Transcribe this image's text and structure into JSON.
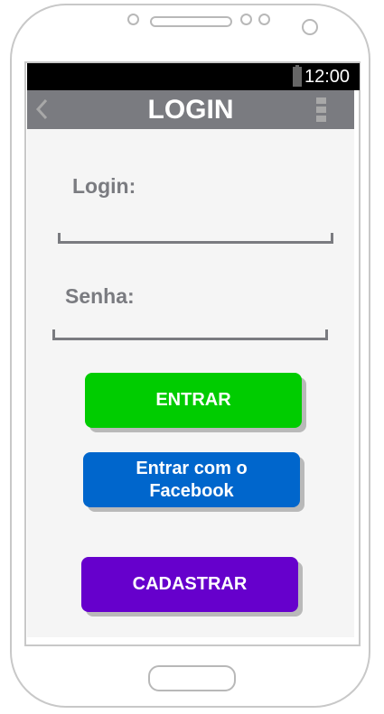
{
  "statusbar": {
    "time": "12:00"
  },
  "appbar": {
    "title": "LOGIN",
    "back_icon": "chevron-left-icon",
    "menu_icon": "more-vertical-icon"
  },
  "form": {
    "login_label": "Login:",
    "password_label": "Senha:"
  },
  "buttons": {
    "enter": "ENTRAR",
    "facebook": "Entrar com o Facebook",
    "register": "CADASTRAR"
  },
  "colors": {
    "appbar": "#7a7b80",
    "enter": "#00cc00",
    "facebook": "#0066cc",
    "register": "#6600cc"
  }
}
